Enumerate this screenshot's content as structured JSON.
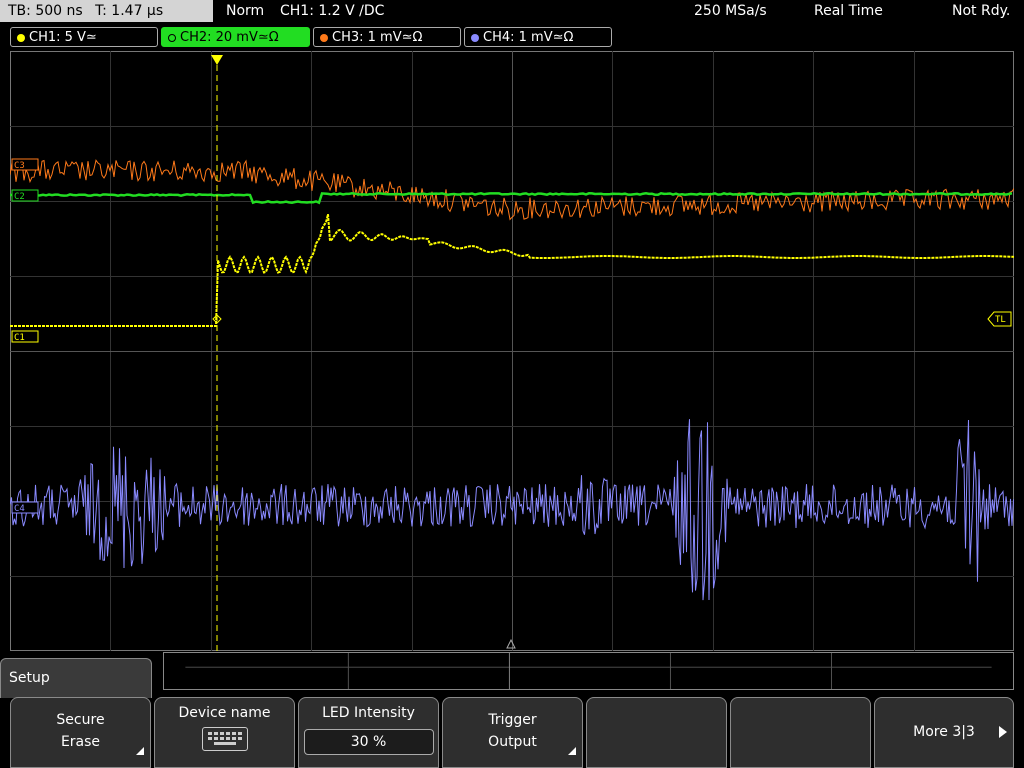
{
  "top_bar": {
    "timebase": "TB: 500 ns",
    "trigger_time": "T: 1.47 µs",
    "mode": "Norm",
    "trigger_info": "CH1: 1.2 V ∕DC",
    "sample_rate": "250 MSa/s",
    "acq_mode": "Real Time",
    "state": "Not Rdy."
  },
  "channels": [
    {
      "label": "CH1: 5 V≃",
      "color": "#ffff00",
      "active": false
    },
    {
      "label": "CH2: 20 mV≃Ω",
      "color": "#22dd22",
      "active": true
    },
    {
      "label": "CH3: 1 mV≃Ω",
      "color": "#ff7a1a",
      "active": false
    },
    {
      "label": "CH4: 1 mV≃Ω",
      "color": "#8a8aff",
      "active": false
    }
  ],
  "markers": {
    "c1": "C1",
    "c2": "C2",
    "c3": "C3",
    "c4": "C4",
    "trigger_level": "TL"
  },
  "menu": {
    "title": "Setup",
    "buttons": [
      {
        "line1": "Secure",
        "line2": "Erase"
      },
      {
        "line1": "Device name"
      },
      {
        "line1": "LED Intensity",
        "value": "30 %"
      },
      {
        "line1": "Trigger",
        "line2": "Output"
      },
      {
        "line1": ""
      },
      {
        "line1": ""
      },
      {
        "line1": "More 3|3"
      }
    ]
  },
  "colors": {
    "ch1": "#ffff00",
    "ch2": "#22dd22",
    "ch3": "#ff7a1a",
    "ch4": "#8a8aff",
    "grid": "#3c3c3c"
  }
}
